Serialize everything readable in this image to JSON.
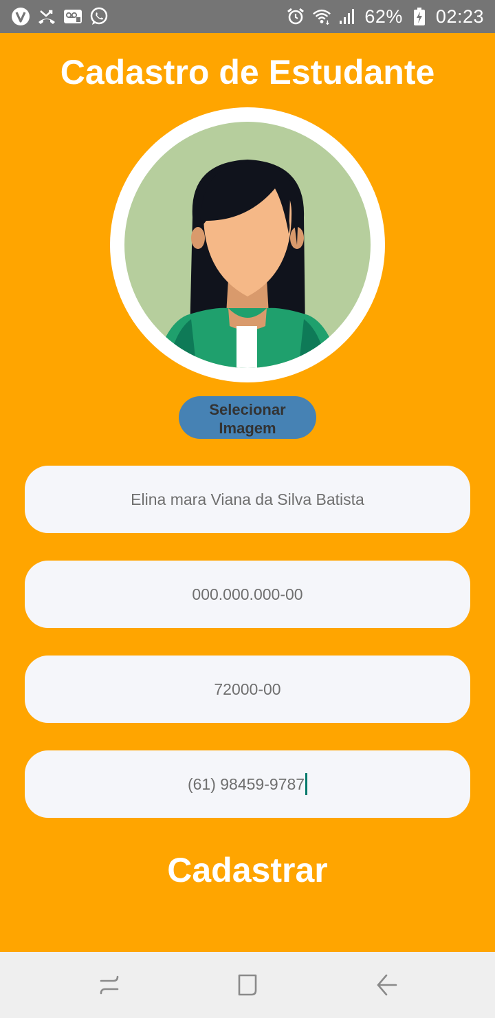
{
  "status_bar": {
    "battery_percent": "62%",
    "time": "02:23",
    "icons_left": [
      "viber-icon",
      "missed-call-icon",
      "voicemail-icon",
      "whatsapp-icon"
    ],
    "icons_right": [
      "alarm-icon",
      "wifi-icon",
      "signal-icon",
      "battery-icon"
    ]
  },
  "page": {
    "title": "Cadastro de Estudante",
    "select_image_label": "Selecionar Imagem",
    "submit_label": "Cadastrar"
  },
  "form": {
    "name_value": "Elina mara Viana da Silva Batista",
    "cpf_value": "000.000.000-00",
    "cep_value": "72000-00",
    "phone_value": "(61) 98459-9787"
  },
  "colors": {
    "background": "#FFA500",
    "button": "#4682B4",
    "field": "#F5F6FA",
    "status_bar": "#757575",
    "nav_bar": "#EFEFEF"
  },
  "nav_bar": {
    "icons": [
      "recent-apps-icon",
      "home-icon",
      "back-icon"
    ]
  }
}
